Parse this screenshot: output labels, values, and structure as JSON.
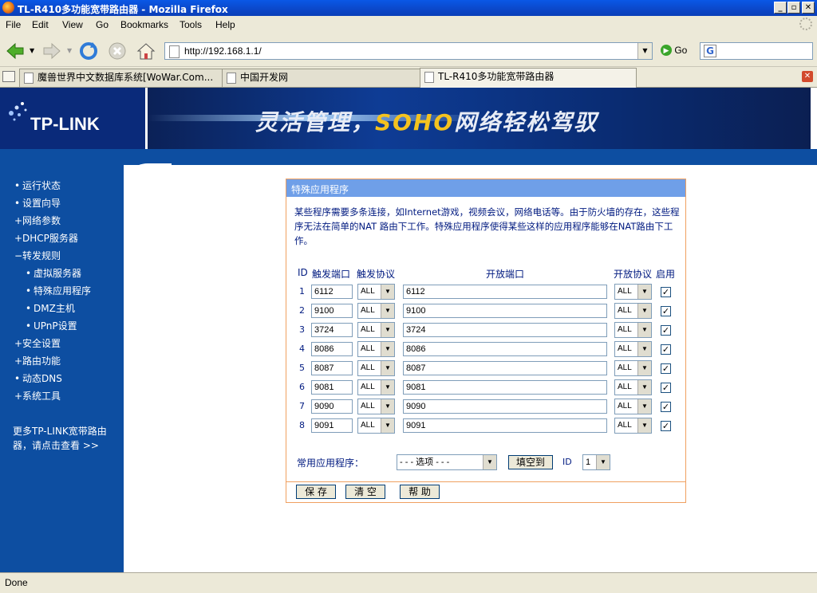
{
  "window": {
    "title": "TL-R410多功能宽带路由器 - Mozilla Firefox",
    "controls": {
      "minimize": "_",
      "maximize": "▫",
      "close": "✕"
    }
  },
  "menu": [
    "File",
    "Edit",
    "View",
    "Go",
    "Bookmarks",
    "Tools",
    "Help"
  ],
  "navbar": {
    "url": "http://192.168.1.1/",
    "go_label": "Go",
    "search_value": ""
  },
  "tabs": [
    {
      "label": "魔兽世界中文数据库系统[WoWar.Com...",
      "active": false
    },
    {
      "label": "中国开发网",
      "active": false
    },
    {
      "label": "TL-R410多功能宽带路由器",
      "active": true
    }
  ],
  "banner": {
    "logo": "TP-LINK",
    "slogan_a": "灵活管理，",
    "slogan_b": "SOHO",
    "slogan_c": "网络轻松驾驭"
  },
  "sidebar": {
    "items": [
      {
        "label": "运行状态",
        "bullet": "•"
      },
      {
        "label": "设置向导",
        "bullet": "•"
      },
      {
        "label": "网络参数",
        "bullet": "+"
      },
      {
        "label": "DHCP服务器",
        "bullet": "+"
      },
      {
        "label": "转发规则",
        "bullet": "−"
      },
      {
        "label": "虚拟服务器",
        "bullet": "•"
      },
      {
        "label": "特殊应用程序",
        "bullet": "•"
      },
      {
        "label": "DMZ主机",
        "bullet": "•"
      },
      {
        "label": "UPnP设置",
        "bullet": "•"
      },
      {
        "label": "安全设置",
        "bullet": "+"
      },
      {
        "label": "路由功能",
        "bullet": "+"
      },
      {
        "label": "动态DNS",
        "bullet": "•"
      },
      {
        "label": "系统工具",
        "bullet": "+"
      }
    ],
    "more_line1": "更多TP-LINK宽带路由",
    "more_line2": "器，请点击查看 >>"
  },
  "panel": {
    "title": "特殊应用程序",
    "description": "某些程序需要多条连接，如Internet游戏，视频会议，网络电话等。由于防火墙的存在，这些程序无法在简单的NAT 路由下工作。特殊应用程序使得某些这样的应用程序能够在NAT路由下工作。",
    "headers": {
      "id": "ID",
      "trigger_port": "触发端口",
      "trigger_protocol": "触发协议",
      "open_port": "开放端口",
      "open_protocol": "开放协议",
      "enable": "启用"
    },
    "rows": [
      {
        "id": "1",
        "trigger_port": "6112",
        "trigger_protocol": "ALL",
        "open_port": "6112",
        "open_protocol": "ALL",
        "enabled": "✓"
      },
      {
        "id": "2",
        "trigger_port": "9100",
        "trigger_protocol": "ALL",
        "open_port": "9100",
        "open_protocol": "ALL",
        "enabled": "✓"
      },
      {
        "id": "3",
        "trigger_port": "3724",
        "trigger_protocol": "ALL",
        "open_port": "3724",
        "open_protocol": "ALL",
        "enabled": "✓"
      },
      {
        "id": "4",
        "trigger_port": "8086",
        "trigger_protocol": "ALL",
        "open_port": "8086",
        "open_protocol": "ALL",
        "enabled": "✓"
      },
      {
        "id": "5",
        "trigger_port": "8087",
        "trigger_protocol": "ALL",
        "open_port": "8087",
        "open_protocol": "ALL",
        "enabled": "✓"
      },
      {
        "id": "6",
        "trigger_port": "9081",
        "trigger_protocol": "ALL",
        "open_port": "9081",
        "open_protocol": "ALL",
        "enabled": "✓"
      },
      {
        "id": "7",
        "trigger_port": "9090",
        "trigger_protocol": "ALL",
        "open_port": "9090",
        "open_protocol": "ALL",
        "enabled": "✓"
      },
      {
        "id": "8",
        "trigger_port": "9091",
        "trigger_protocol": "ALL",
        "open_port": "9091",
        "open_protocol": "ALL",
        "enabled": "✓"
      }
    ],
    "common_apps_label": "常用应用程序：",
    "common_apps_value": "- - - 选项 - - -",
    "fill_button": "填空到",
    "id_label": "ID",
    "id_value": "1",
    "save_button": "保 存",
    "clear_button": "清 空",
    "help_button": "帮 助"
  },
  "status": "Done",
  "colors": {
    "sidebar_bg": "#0d4ea1",
    "panel_header": "#6f9fe8",
    "panel_border": "#f0a060",
    "label_text": "#001a80"
  }
}
